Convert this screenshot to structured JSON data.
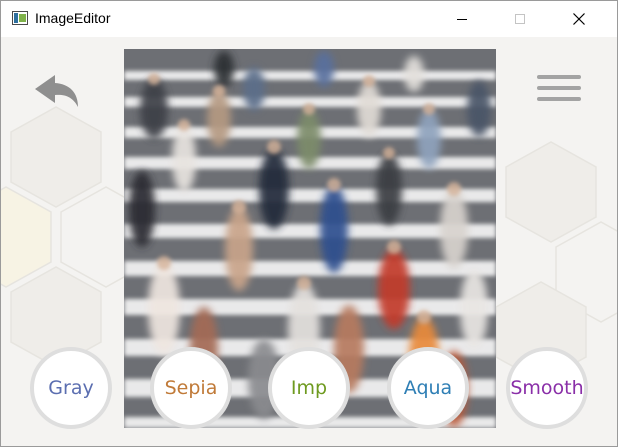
{
  "window": {
    "title": "ImageEditor"
  },
  "toolbar": {
    "back_icon": "undo-arrow-icon",
    "menu_icon": "hamburger-menu-icon"
  },
  "image": {
    "description_name": "crowd-crosswalk-photo"
  },
  "filters": [
    {
      "label": "Gray",
      "color": "#5b6eb0"
    },
    {
      "label": "Sepia",
      "color": "#c07a38"
    },
    {
      "label": "Imp",
      "color": "#6e9a1f"
    },
    {
      "label": "Aqua",
      "color": "#2f7fb5"
    },
    {
      "label": "Smooth",
      "color": "#8a2fa8"
    }
  ]
}
